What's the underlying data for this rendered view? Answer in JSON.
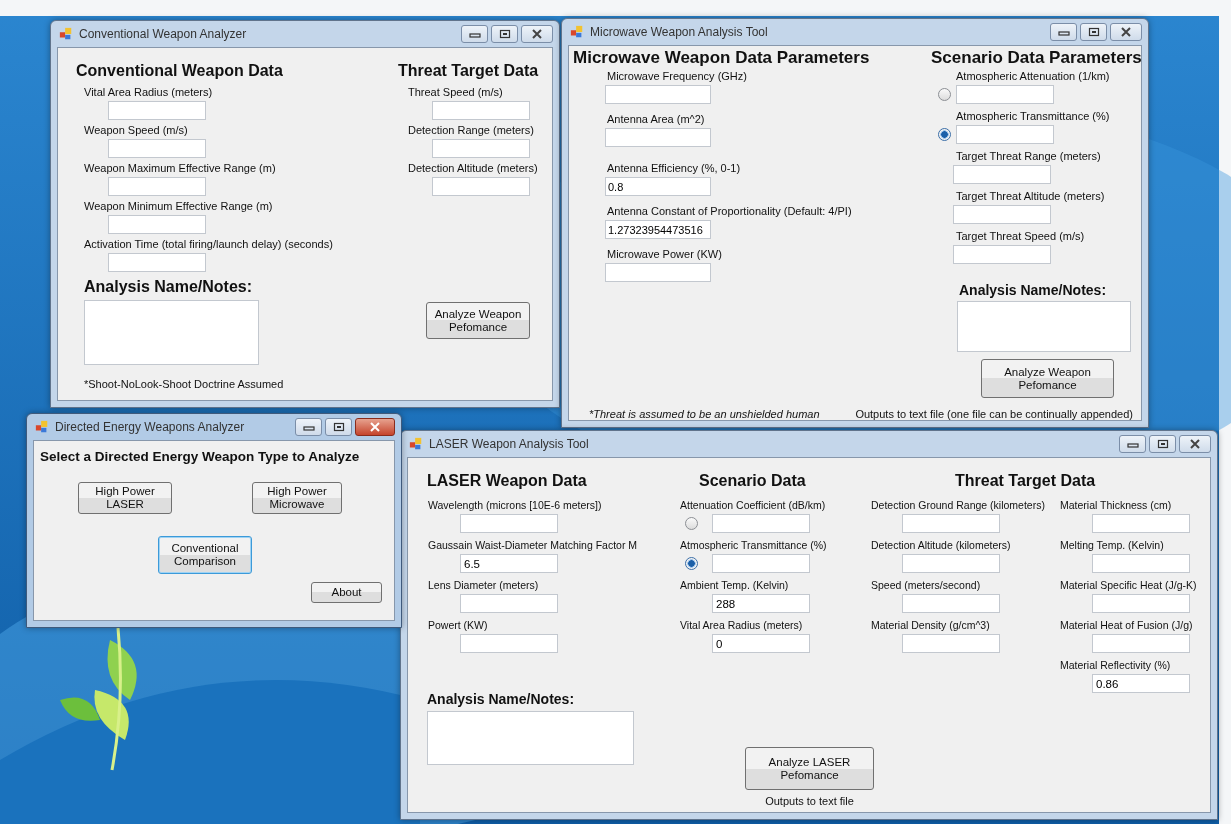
{
  "windows": [
    {
      "kind": "conventional",
      "title": "Conventional Weapon Analyzer",
      "active": false,
      "columns": [
        {
          "heading": "Conventional Weapon Data",
          "fields": [
            {
              "kind": "text",
              "label": "Vital Area Radius (meters)"
            },
            {
              "kind": "text",
              "label": "Weapon Speed (m/s)"
            },
            {
              "kind": "text",
              "label": "Weapon Maximum Effective Range (m)"
            },
            {
              "kind": "text",
              "label": "Weapon Minimum Effective Range (m)"
            },
            {
              "kind": "text",
              "label": "Activation Time (total firing/launch delay) (seconds)"
            }
          ]
        },
        {
          "heading": "Threat Target Data",
          "fields": [
            {
              "kind": "text",
              "label": "Threat Speed (m/s)"
            },
            {
              "kind": "text",
              "label": "Detection Range (meters)"
            },
            {
              "kind": "text",
              "label": "Detection Altitude (meters)"
            }
          ]
        }
      ],
      "notes_heading": "Analysis Name/Notes:",
      "buttons": [
        {
          "label": "Analyze Weapon Pefomance",
          "focused": false
        }
      ],
      "footnotes": [
        "*Shoot-NoLook-Shoot Doctrine Assumed"
      ]
    },
    {
      "kind": "microwave",
      "title": "Microwave Weapon Analysis Tool",
      "active": false,
      "columns": [
        {
          "heading": "Microwave Weapon Data Parameters",
          "fields": [
            {
              "kind": "text",
              "label": "Microwave Frequency (GHz)"
            },
            {
              "kind": "text",
              "label": "Antenna Area (m^2)"
            },
            {
              "kind": "text",
              "label": "Antenna Efficiency (%, 0-1)",
              "value": "0.8"
            },
            {
              "kind": "text",
              "label": "Antenna Constant of Proportionality (Default: 4/PI)",
              "value": "1.27323954473516"
            },
            {
              "kind": "text",
              "label": "Microwave Power (KW)"
            }
          ]
        },
        {
          "heading": "Scenario Data Parameters",
          "fields": [
            {
              "kind": "radio",
              "label": "Atmospheric Attenuation (1/km)",
              "selected": false
            },
            {
              "kind": "radio",
              "label": "Atmospheric Transmittance (%)",
              "selected": true
            },
            {
              "kind": "text",
              "label": "Target Threat Range (meters)"
            },
            {
              "kind": "text",
              "label": "Target Threat Altitude (meters)"
            },
            {
              "kind": "text",
              "label": "Target Threat Speed (m/s)"
            }
          ]
        }
      ],
      "notes_heading": "Analysis Name/Notes:",
      "buttons": [
        {
          "label": "Analyze Weapon Pefomance",
          "focused": false
        }
      ],
      "footnotes": [
        "*Threat is assumed to be an unshielded human",
        "Outputs to text file (one file can be continually appended)"
      ]
    },
    {
      "kind": "selector",
      "title": "Directed Energy Weapons Analyzer",
      "active": true,
      "heading": "Select a Directed Energy Weapon Type to Analyze",
      "buttons": [
        {
          "label": "High Power LASER",
          "focused": false
        },
        {
          "label": "High Power Microwave",
          "focused": false
        },
        {
          "label": "Conventional Comparison",
          "focused": true
        },
        {
          "label": "About",
          "focused": false
        }
      ]
    },
    {
      "kind": "laser",
      "title": "LASER Weapon Analysis Tool",
      "active": false,
      "columns": [
        {
          "heading": "LASER Weapon Data",
          "fields": [
            {
              "kind": "text",
              "label": "Wavelength (microns [10E-6 meters])"
            },
            {
              "kind": "text",
              "label": "Gaussain Waist-Diameter Matching Factor M",
              "value": "6.5"
            },
            {
              "kind": "text",
              "label": "Lens Diameter (meters)"
            },
            {
              "kind": "text",
              "label": "Powert (KW)"
            }
          ]
        },
        {
          "heading": "Scenario Data",
          "fields": [
            {
              "kind": "radio",
              "label": "Attenuation Coefficient (dB/km)",
              "selected": false
            },
            {
              "kind": "radio",
              "label": "Atmospheric Transmittance (%)",
              "selected": true
            },
            {
              "kind": "text",
              "label": "Ambient Temp. (Kelvin)",
              "value": "288"
            },
            {
              "kind": "text",
              "label": "Vital Area Radius (meters)",
              "value": "0"
            }
          ]
        },
        {
          "heading": "Threat Target Data",
          "fields": [
            {
              "kind": "text",
              "label": "Detection Ground Range (kilometers)"
            },
            {
              "kind": "text",
              "label": "Detection Altitude (kilometers)"
            },
            {
              "kind": "text",
              "label": "Speed (meters/second)"
            },
            {
              "kind": "text",
              "label": "Material Density (g/cm^3)"
            }
          ]
        },
        {
          "fields": [
            {
              "kind": "text",
              "label": "Material Thickness (cm)"
            },
            {
              "kind": "text",
              "label": "Melting Temp. (Kelvin)"
            },
            {
              "kind": "text",
              "label": "Material Specific Heat (J/g-K)"
            },
            {
              "kind": "text",
              "label": "Material Heat of Fusion (J/g)"
            },
            {
              "kind": "text",
              "label": "Material Reflectivity (%)",
              "value": "0.86"
            }
          ]
        }
      ],
      "notes_heading": "Analysis Name/Notes:",
      "buttons": [
        {
          "label": "Analyze LASER Pefomance",
          "focused": false
        }
      ],
      "footnotes": [
        "Outputs to text file"
      ]
    }
  ]
}
